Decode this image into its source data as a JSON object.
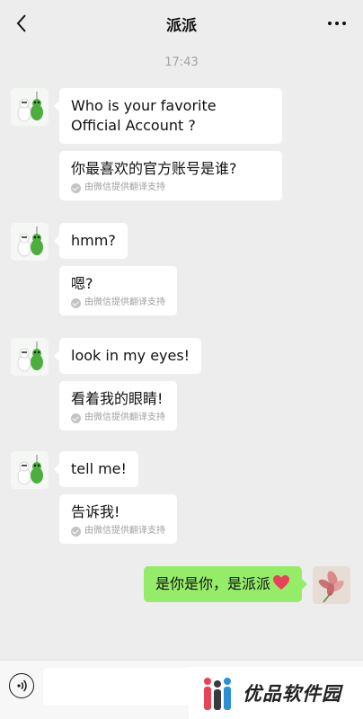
{
  "header": {
    "title": "派派"
  },
  "timestamp": "17:43",
  "messages": [
    {
      "text": "Who is your favorite Official Account ?",
      "translation": "你最喜欢的官方账号是谁?",
      "note": "由微信提供翻译支持"
    },
    {
      "text": "hmm?",
      "translation": "嗯?",
      "note": "由微信提供翻译支持"
    },
    {
      "text": "look in my eyes!",
      "translation": "看着我的眼睛!",
      "note": "由微信提供翻译支持"
    },
    {
      "text": "tell me!",
      "translation": "告诉我!",
      "note": "由微信提供翻译支持"
    }
  ],
  "my_message": {
    "text": "是你是你，是派派"
  },
  "input": {
    "value": ""
  },
  "watermark": {
    "text": "优品软件园"
  },
  "icons": {
    "back": "chevron-left-icon",
    "more": "more-dots-icon",
    "check": "check-circle-icon",
    "heart": "heart-icon",
    "voice": "voice-icon"
  },
  "colors": {
    "background": "#ededed",
    "incoming_bubble": "#ffffff",
    "outgoing_bubble": "#95ec69",
    "heart": "#e8415a",
    "timestamp": "#a3a3a3"
  }
}
